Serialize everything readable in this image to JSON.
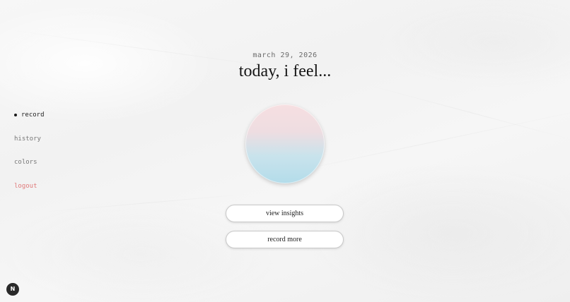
{
  "header": {
    "date": "march 29, 2026",
    "title": "today, i feel..."
  },
  "sidebar": {
    "items": [
      {
        "label": "record",
        "active": true
      },
      {
        "label": "history",
        "active": false
      },
      {
        "label": "colors",
        "active": false
      },
      {
        "label": "logout",
        "active": false
      }
    ]
  },
  "mood_orb": {
    "gradient_top": "#f6dfe1",
    "gradient_bottom": "#b3dcea"
  },
  "actions": {
    "view_insights_label": "view insights",
    "record_more_label": "record more"
  },
  "dev_badge": {
    "letter": "N"
  },
  "colors": {
    "logout": "#e07a7a",
    "background": "#f4f4f4"
  }
}
